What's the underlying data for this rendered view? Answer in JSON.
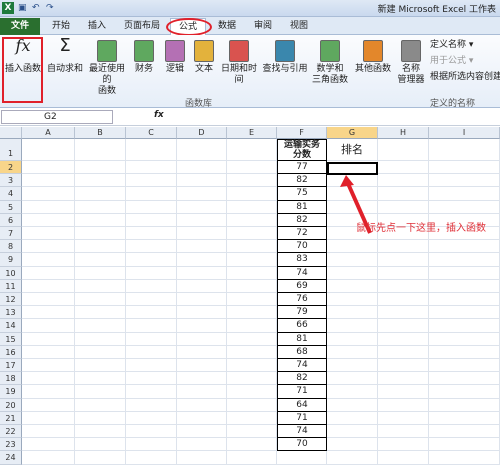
{
  "titlebar": {
    "title": "新建 Microsoft Excel 工作表"
  },
  "tabs": [
    "文件",
    "开始",
    "插入",
    "页面布局",
    "公式",
    "数据",
    "审阅",
    "视图"
  ],
  "ribbon": {
    "buttons": [
      {
        "label": "插入函数",
        "icon": "fx-icon",
        "color": "#333333"
      },
      {
        "label": "自动求和",
        "icon": "sigma-icon",
        "color": "#333333"
      },
      {
        "label": "最近使用的\n函数",
        "icon": "recent-icon",
        "color": "#5fa85f"
      },
      {
        "label": "财务",
        "icon": "finance-icon",
        "color": "#5fa85f"
      },
      {
        "label": "逻辑",
        "icon": "logic-icon",
        "color": "#b470b4"
      },
      {
        "label": "文本",
        "icon": "text-icon",
        "color": "#e3b23c"
      },
      {
        "label": "日期和时间",
        "icon": "datetime-icon",
        "color": "#d9534f"
      },
      {
        "label": "查找与引用",
        "icon": "lookup-icon",
        "color": "#3a87ad"
      },
      {
        "label": "数学和\n三角函数",
        "icon": "math-icon",
        "color": "#5fa85f"
      },
      {
        "label": "其他函数",
        "icon": "more-icon",
        "color": "#e3872b"
      },
      {
        "label": "名称\n管理器",
        "icon": "name-manager-icon",
        "color": "#8a8a8a"
      }
    ],
    "group_function_library": "函数库",
    "names": {
      "define": "定义名称",
      "use_in_formula": "用于公式",
      "create_from_selection": "根据所选内容创建",
      "group": "定义的名称"
    }
  },
  "namebox": {
    "value": "G2"
  },
  "fx_symbol": "fx",
  "columns": [
    "A",
    "B",
    "C",
    "D",
    "E",
    "F",
    "G",
    "H",
    "I"
  ],
  "rows": [
    "1",
    "2",
    "3",
    "4",
    "5",
    "6",
    "7",
    "8",
    "9",
    "10",
    "11",
    "12",
    "13",
    "14",
    "15",
    "16",
    "17",
    "18",
    "19",
    "20",
    "21",
    "22",
    "23",
    "24"
  ],
  "f_header": "运输实务\n分数",
  "g_header": "排名",
  "f_values": [
    "77",
    "82",
    "75",
    "81",
    "82",
    "72",
    "70",
    "83",
    "74",
    "69",
    "76",
    "79",
    "66",
    "81",
    "68",
    "74",
    "82",
    "71",
    "64",
    "71",
    "74",
    "70"
  ],
  "callout": "鼠标先点一下这里，插入函数",
  "accent": "#e0202a"
}
